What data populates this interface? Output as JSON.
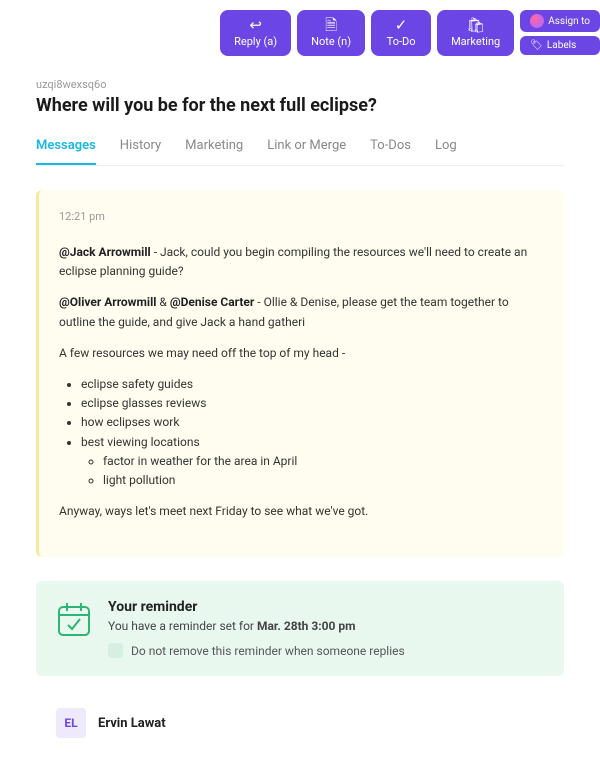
{
  "toolbar": {
    "reply": "Reply (a)",
    "note": "Note (n)",
    "todo": "To-Do",
    "marketing": "Marketing",
    "assign": "Assign to",
    "labels": "Labels"
  },
  "conversation": {
    "id": "uzqi8wexsq6o",
    "title": "Where will you be for the next full eclipse?"
  },
  "tabs": {
    "messages": "Messages",
    "history": "History",
    "marketing": "Marketing",
    "link": "Link or Merge",
    "todos": "To-Dos",
    "log": "Log"
  },
  "message": {
    "time": "12:21 pm",
    "m1a": "@Jack Arrowmill",
    "m1b": " - Jack, could you begin compiling the resources we'll need to create an eclipse planning guide?",
    "m2a": "@Oliver Arrowmill",
    "m2amp": " & ",
    "m2b": "@Denise Carter",
    "m2c": " - Ollie & Denise, please get the team together to outline the guide, and give Jack a hand gatheri",
    "lead": "A few resources we may need off the top of my head -",
    "li1": "eclipse safety guides",
    "li2": "eclipse glasses reviews",
    "li3": "how eclipses work",
    "li4": "best viewing locations",
    "li4a": "factor in weather for the area in April",
    "li4b": "light pollution",
    "close": "Anyway, ways let's meet next Friday to see what we've got."
  },
  "reminder": {
    "title": "Your reminder",
    "text_pre": "You have a reminder set for ",
    "date": "Mar. 28th 3:00 pm",
    "checkbox_label": "Do not remove this reminder when someone replies"
  },
  "reply_author": {
    "initials": "EL",
    "name": "Ervin Lawat"
  }
}
